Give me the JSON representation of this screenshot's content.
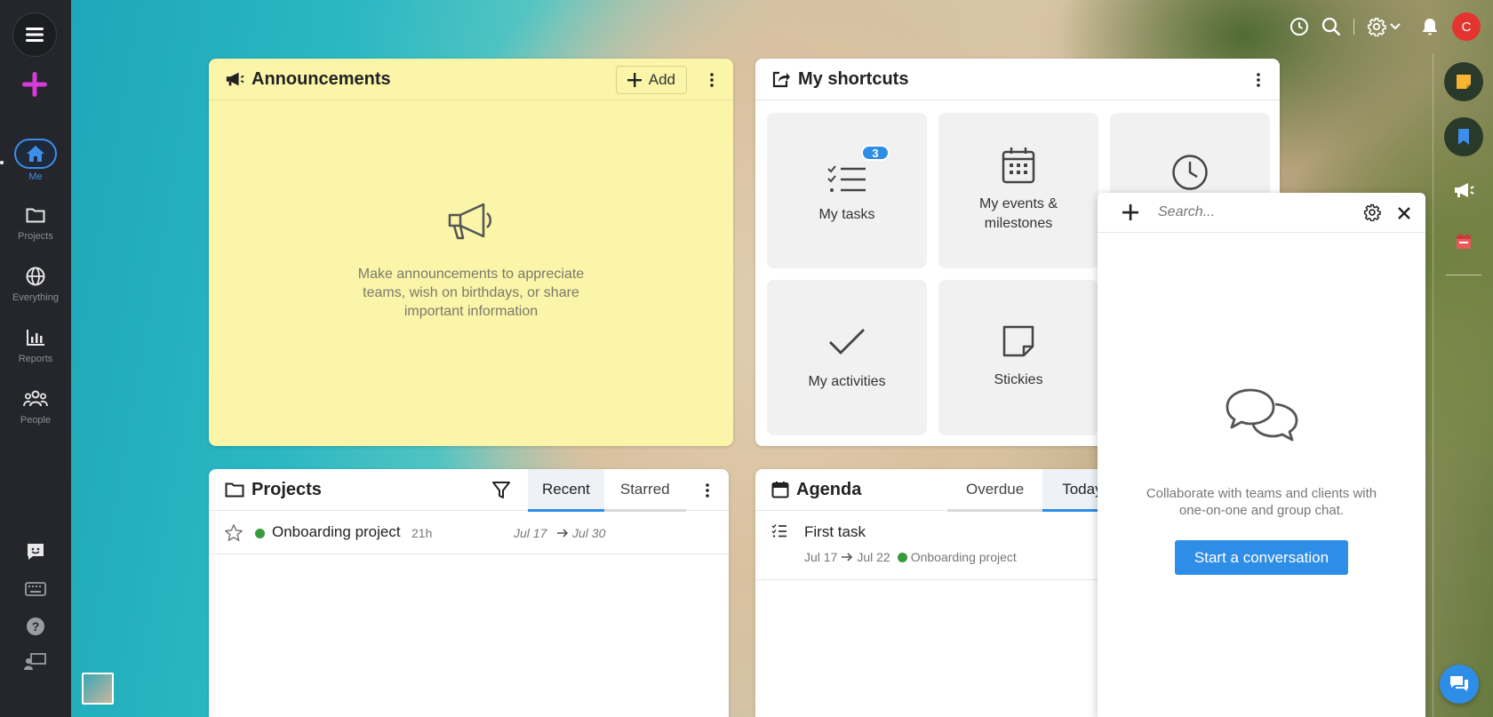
{
  "leftnav": {
    "items": [
      {
        "label": "Me"
      },
      {
        "label": "Projects"
      },
      {
        "label": "Everything"
      },
      {
        "label": "Reports"
      },
      {
        "label": "People"
      }
    ]
  },
  "topbar": {
    "avatar_initial": "C"
  },
  "announcements": {
    "title": "Announcements",
    "add_label": "Add",
    "empty_text": "Make announcements to appreciate teams, wish on birthdays, or share important information"
  },
  "shortcuts": {
    "title": "My shortcuts",
    "tiles": [
      {
        "label": "My tasks",
        "badge": "3"
      },
      {
        "label": "My events & milestones"
      },
      {
        "label": ""
      },
      {
        "label": "My activities"
      },
      {
        "label": "Stickies"
      }
    ]
  },
  "projects": {
    "title": "Projects",
    "tabs": [
      "Recent",
      "Starred"
    ],
    "rows": [
      {
        "name": "Onboarding project",
        "age": "21h",
        "start": "Jul 17",
        "end": "Jul 30"
      }
    ]
  },
  "agenda": {
    "title": "Agenda",
    "tabs": [
      "Overdue",
      "Today"
    ],
    "rows": [
      {
        "title": "First task",
        "start": "Jul 17",
        "end": "Jul 22",
        "project": "Onboarding project"
      }
    ]
  },
  "chat": {
    "search_placeholder": "Search...",
    "empty_text": "Collaborate with teams and clients with one-on-one and group chat.",
    "start_label": "Start a conversation"
  },
  "colors": {
    "accent": "#2e8de6",
    "nav_bg": "#24262b",
    "announcement_bg": "#fbf5a9",
    "project_dot": "#3a9a3e",
    "avatar": "#e3342f",
    "plus": "#d63ad8"
  }
}
